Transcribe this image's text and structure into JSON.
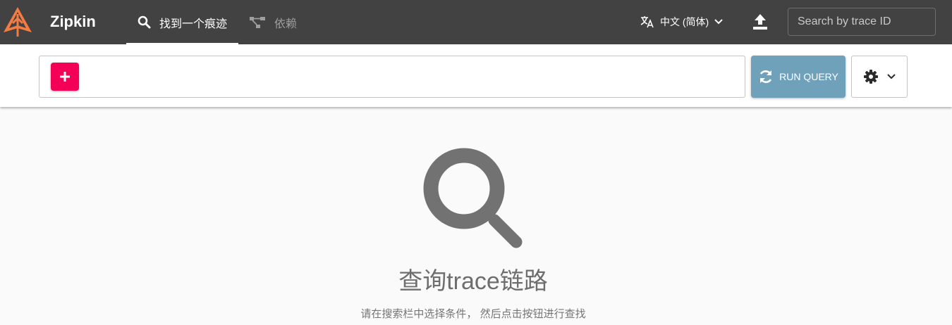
{
  "app": {
    "brand": "Zipkin",
    "brand_color": "#f47b42"
  },
  "nav": {
    "tabs": [
      {
        "label": "找到一个痕迹",
        "icon": "search-icon",
        "active": true
      },
      {
        "label": "依赖",
        "icon": "dependencies-icon",
        "active": false
      }
    ]
  },
  "header": {
    "language_label": "中文 (简体)",
    "language_icon": "translate-icon",
    "upload_icon": "upload-icon",
    "trace_search_placeholder": "Search by trace ID"
  },
  "query": {
    "add_icon": "plus-icon",
    "add_color": "#f50057",
    "run_label": "RUN QUERY",
    "run_icon": "refresh-icon",
    "run_color": "#6fa1ba",
    "settings_icon": "gear-icon"
  },
  "empty_state": {
    "icon": "search-icon",
    "title": "查询trace链路",
    "subtitle": "请在搜索栏中选择条件， 然后点击按钮进行查找"
  }
}
